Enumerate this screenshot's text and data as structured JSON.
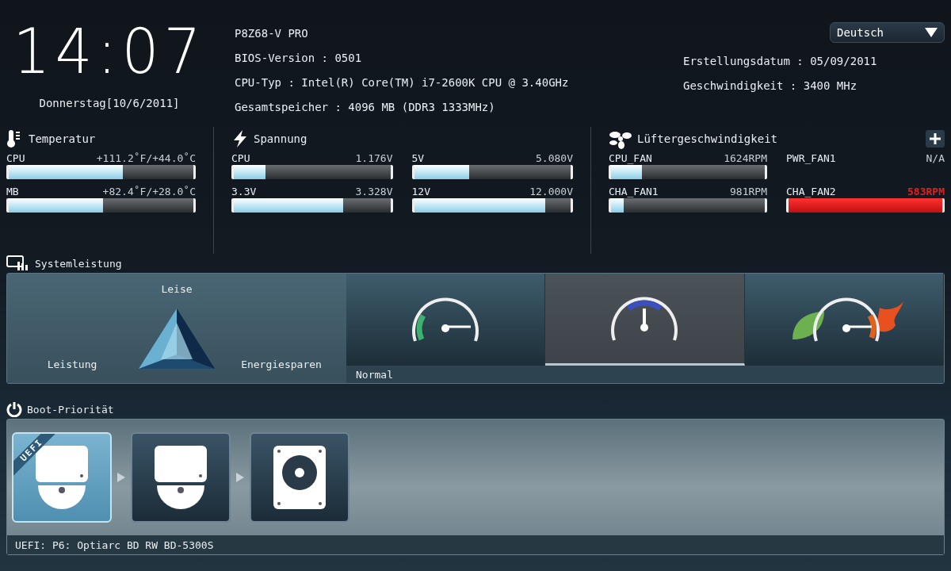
{
  "clock": {
    "time": "14:07",
    "date": "Donnerstag[10/6/2011]"
  },
  "info": {
    "left": [
      "P8Z68-V PRO",
      "BIOS-Version : 0501",
      "CPU-Typ : Intel(R) Core(TM) i7-2600K CPU @ 3.40GHz",
      "Gesamtspeicher : 4096 MB (DDR3 1333MHz)"
    ],
    "language": "Deutsch",
    "right": [
      "Erstellungsdatum : 05/09/2011",
      "Geschwindigkeit : 3400 MHz"
    ]
  },
  "temperature": {
    "title": "Temperatur",
    "sensors": [
      {
        "name": "CPU",
        "reading": "+111.2˚F/+44.0˚C",
        "level": 0.62
      },
      {
        "name": "MB",
        "reading": "+82.4˚F/+28.0˚C",
        "level": 0.51
      }
    ]
  },
  "voltage": {
    "title": "Spannung",
    "sensors": [
      {
        "name": "CPU",
        "reading": "1.176V",
        "level": 0.2
      },
      {
        "name": "5V",
        "reading": "5.080V",
        "level": 0.35
      },
      {
        "name": "3.3V",
        "reading": "3.328V",
        "level": 0.7
      },
      {
        "name": "12V",
        "reading": "12.000V",
        "level": 0.84
      }
    ]
  },
  "fans": {
    "title": "Lüftergeschwindigkeit",
    "sensors": [
      {
        "name": "CPU_FAN",
        "reading": "1624RPM",
        "kind": "bar",
        "alert": false,
        "level": 0.2
      },
      {
        "name": "PWR_FAN1",
        "reading": "N/A",
        "kind": "none",
        "alert": false
      },
      {
        "name": "CHA_FAN1",
        "reading": "981RPM",
        "kind": "bar",
        "alert": false,
        "level": 0.08
      },
      {
        "name": "CHA_FAN2",
        "reading": "583RPM",
        "kind": "bar",
        "alert": true,
        "level": 1
      }
    ]
  },
  "performance": {
    "title": "Systemleistung",
    "top": "Leise",
    "left": "Leistung",
    "right": "Energiesparen",
    "caption": "Normal",
    "modes": [
      {
        "kind": "green",
        "selected": false
      },
      {
        "kind": "blue",
        "selected": true
      },
      {
        "kind": "eco",
        "selected": false
      }
    ]
  },
  "boot": {
    "title": "Boot-Priorität",
    "badge": "UEFI",
    "caption": "UEFI: P6: Optiarc BD RW BD-5300S",
    "devices": [
      {
        "kind": "disc",
        "uefi": true,
        "selected": true
      },
      {
        "kind": "disc",
        "uefi": false,
        "selected": false
      },
      {
        "kind": "hdd",
        "uefi": false,
        "selected": false
      }
    ]
  }
}
